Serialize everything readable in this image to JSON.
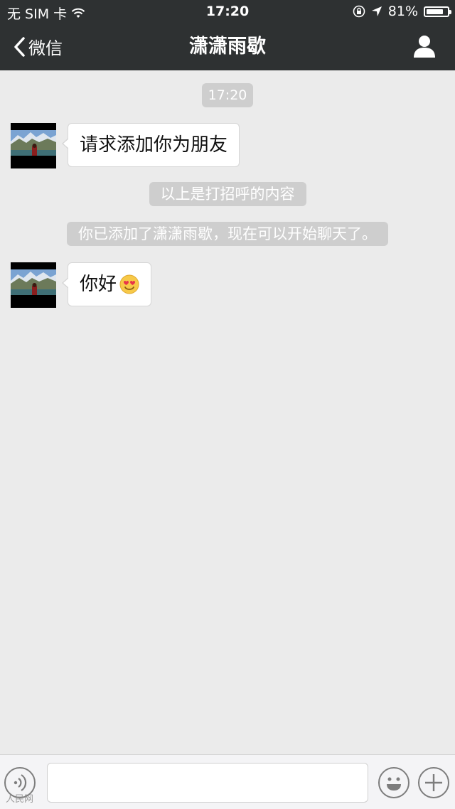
{
  "status_bar": {
    "carrier": "无 SIM 卡",
    "time": "17:20",
    "battery_percent": "81%",
    "battery_level": 0.81,
    "icons": [
      "wifi-icon",
      "orientation-lock-icon",
      "location-arrow-icon",
      "battery-icon"
    ]
  },
  "nav": {
    "back_label": "微信",
    "title": "潇潇雨歇",
    "profile_icon": "person-icon"
  },
  "chat": {
    "timestamp": "17:20",
    "messages": [
      {
        "text": "请求添加你为朋友"
      },
      {
        "text": "你好",
        "emoji": "smiling-face-with-heart-eyes-icon"
      }
    ],
    "system_messages": [
      "以上是打招呼的内容",
      "你已添加了潇潇雨歇，现在可以开始聊天了。"
    ]
  },
  "input_bar": {
    "text_value": "",
    "icons": [
      "voice-icon",
      "emoji-icon",
      "plus-icon"
    ]
  },
  "watermark": "人民网"
}
